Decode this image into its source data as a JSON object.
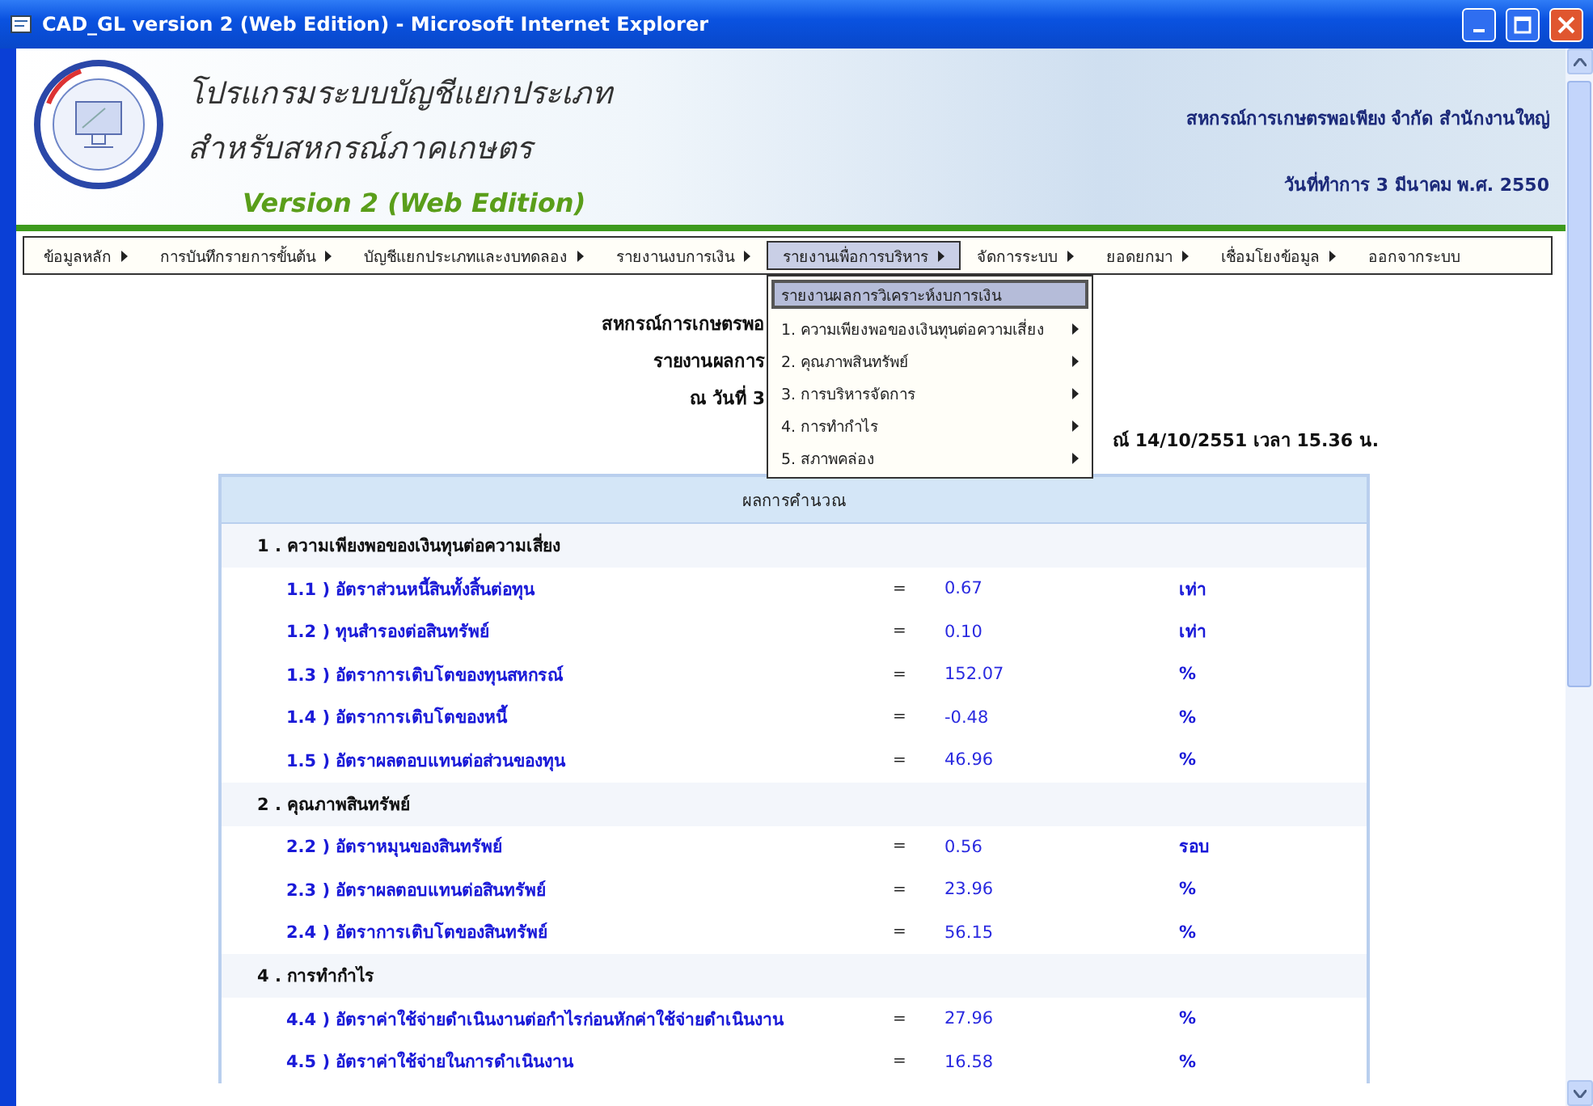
{
  "window": {
    "title": "CAD_GL version 2 (Web Edition) - Microsoft Internet Explorer"
  },
  "banner": {
    "title_lines": [
      "โปรแกรมระบบบัญชีแยกประเภท",
      "สำหรับสหกรณ์ภาคเกษตร"
    ],
    "version": "Version 2 (Web Edition)",
    "organization": "สหกรณ์การเกษตรพอเพียง จำกัด สำนักงานใหญ่",
    "date": "วันที่ทำการ 3 มีนาคม พ.ศ. 2550"
  },
  "menu": {
    "items": [
      {
        "label": "ข้อมูลหลัก",
        "selected": false,
        "has_submenu": true
      },
      {
        "label": "การบันทึกรายการขั้นต้น",
        "selected": false,
        "has_submenu": true
      },
      {
        "label": "บัญชีแยกประเภทและงบทดลอง",
        "selected": false,
        "has_submenu": true
      },
      {
        "label": "รายงานงบการเงิน",
        "selected": false,
        "has_submenu": true
      },
      {
        "label": "รายงานเพื่อการบริหาร",
        "selected": true,
        "has_submenu": true
      },
      {
        "label": "จัดการระบบ",
        "selected": false,
        "has_submenu": true
      },
      {
        "label": "ยอดยกมา",
        "selected": false,
        "has_submenu": true
      },
      {
        "label": "เชื่อมโยงข้อมูล",
        "selected": false,
        "has_submenu": true
      },
      {
        "label": "ออกจากระบบ",
        "selected": false,
        "has_submenu": false
      }
    ]
  },
  "dropdown": {
    "items": [
      {
        "label": "รายงานผลการวิเคราะห์งบการเงิน",
        "selected": true,
        "has_submenu": false
      },
      {
        "label": "1. ความเพียงพอของเงินทุนต่อความเสี่ยง",
        "selected": false,
        "has_submenu": true
      },
      {
        "label": "2. คุณภาพสินทรัพย์",
        "selected": false,
        "has_submenu": true
      },
      {
        "label": "3. การบริหารจัดการ",
        "selected": false,
        "has_submenu": true
      },
      {
        "label": "4. การทำกำไร",
        "selected": false,
        "has_submenu": true
      },
      {
        "label": "5. สภาพคล่อง",
        "selected": false,
        "has_submenu": true
      }
    ]
  },
  "report": {
    "header_lines": [
      "สหกรณ์การเกษตรพอ",
      "รายงานผลการ",
      "ณ วันที่ 3"
    ],
    "timestamp": "ณ์ 14/10/2551 เวลา 15.36 น."
  },
  "results": {
    "heading": "ผลการคำนวณ",
    "sections": [
      {
        "title": "1 . ความเพียงพอของเงินทุนต่อความเสี่ยง",
        "rows": [
          {
            "label": "1.1 ) อัตราส่วนหนี้สินทั้งสิ้นต่อทุน",
            "eq": "=",
            "value": "0.67",
            "unit": "เท่า"
          },
          {
            "label": "1.2 ) ทุนสำรองต่อสินทรัพย์",
            "eq": "=",
            "value": "0.10",
            "unit": "เท่า"
          },
          {
            "label": "1.3 ) อัตราการเติบโตของทุนสหกรณ์",
            "eq": "=",
            "value": "152.07",
            "unit": "%"
          },
          {
            "label": "1.4 ) อัตราการเติบโตของหนี้",
            "eq": "=",
            "value": "-0.48",
            "unit": "%"
          },
          {
            "label": "1.5 ) อัตราผลตอบแทนต่อส่วนของทุน",
            "eq": "=",
            "value": "46.96",
            "unit": "%"
          }
        ]
      },
      {
        "title": "2 . คุณภาพสินทรัพย์",
        "rows": [
          {
            "label": "2.2 ) อัตราหมุนของสินทรัพย์",
            "eq": "=",
            "value": "0.56",
            "unit": "รอบ"
          },
          {
            "label": "2.3 ) อัตราผลตอบแทนต่อสินทรัพย์",
            "eq": "=",
            "value": "23.96",
            "unit": "%"
          },
          {
            "label": "2.4 ) อัตราการเติบโตของสินทรัพย์",
            "eq": "=",
            "value": "56.15",
            "unit": "%"
          }
        ]
      },
      {
        "title": "4 . การทำกำไร",
        "rows": [
          {
            "label": "4.4 ) อัตราค่าใช้จ่ายดำเนินงานต่อกำไรก่อนหักค่าใช้จ่ายดำเนินงาน",
            "eq": "=",
            "value": "27.96",
            "unit": "%"
          },
          {
            "label": "4.5 ) อัตราค่าใช้จ่ายในการดำเนินงาน",
            "eq": "=",
            "value": "16.58",
            "unit": "%"
          }
        ]
      }
    ]
  }
}
